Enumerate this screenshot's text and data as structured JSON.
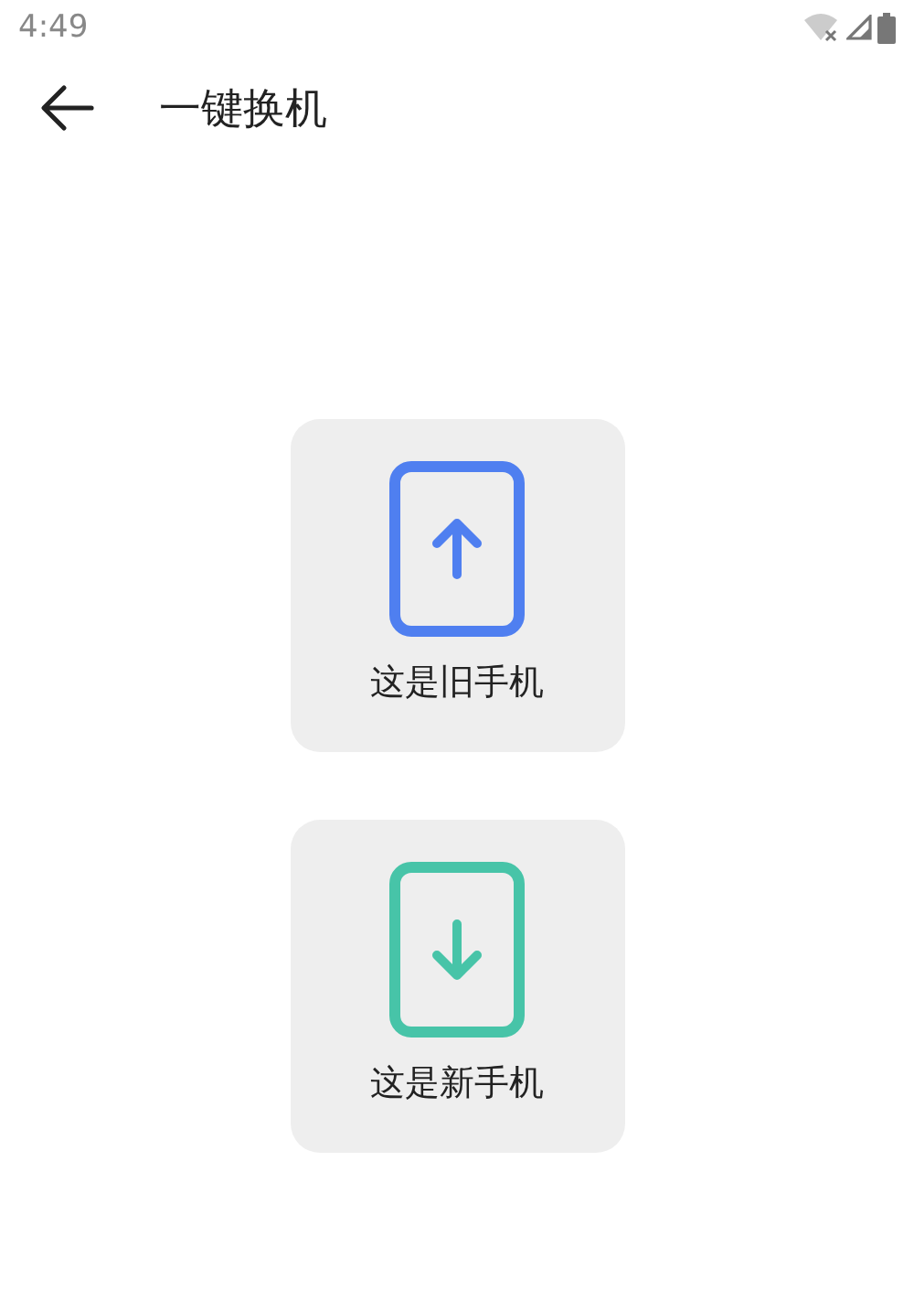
{
  "status_bar": {
    "time": "4:49"
  },
  "header": {
    "title": "一键换机"
  },
  "options": [
    {
      "kind": "upload",
      "label": "这是旧手机",
      "color": "#4f7ff0"
    },
    {
      "kind": "download",
      "label": "这是新手机",
      "color": "#47c4a8"
    }
  ]
}
